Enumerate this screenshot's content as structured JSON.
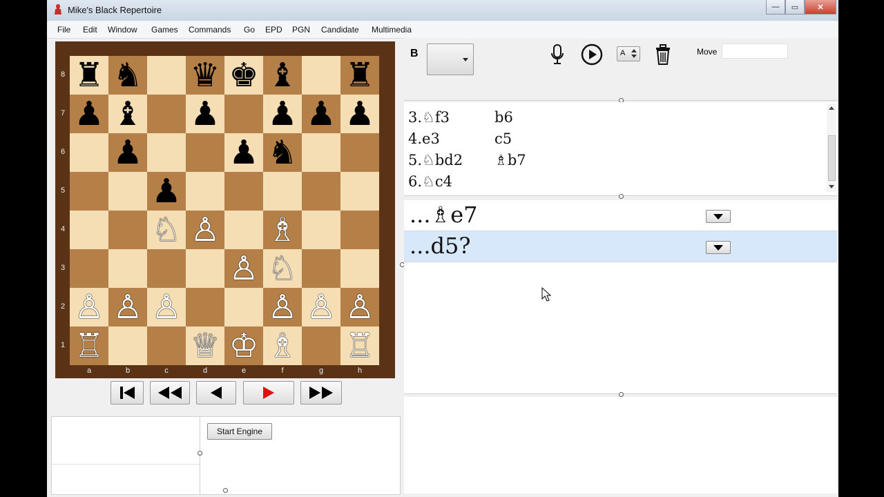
{
  "window": {
    "title": "Mike's Black Repertoire",
    "minimize": "—",
    "maximize": "▭",
    "close": "✕"
  },
  "menu": [
    "File",
    "Edit",
    "Window",
    "Games",
    "Commands",
    "Go",
    "EPD",
    "PGN",
    "Candidate",
    "Multimedia"
  ],
  "board": {
    "ranks": [
      "8",
      "7",
      "6",
      "5",
      "4",
      "3",
      "2",
      "1"
    ],
    "files": [
      "a",
      "b",
      "c",
      "d",
      "e",
      "f",
      "g",
      "h"
    ],
    "position": [
      [
        "bR",
        "bN",
        "",
        "bQ",
        "bK",
        "bB",
        "",
        "bR"
      ],
      [
        "bP",
        "bB",
        "",
        "bP",
        "",
        "bP",
        "bP",
        "bP"
      ],
      [
        "",
        "bP",
        "",
        "",
        "bP",
        "bN",
        "",
        ""
      ],
      [
        "",
        "",
        "bP",
        "",
        "",
        "",
        "",
        ""
      ],
      [
        "",
        "",
        "wN",
        "wP",
        "",
        "wB",
        "",
        ""
      ],
      [
        "",
        "",
        "",
        "",
        "wP",
        "wN",
        "",
        ""
      ],
      [
        "wP",
        "wP",
        "wP",
        "",
        "",
        "wP",
        "wP",
        "wP"
      ],
      [
        "wR",
        "",
        "",
        "wQ",
        "wK",
        "wB",
        "",
        "wR"
      ]
    ],
    "glyphs": {
      "bR": "♜",
      "bN": "♞",
      "bB": "♝",
      "bQ": "♛",
      "bK": "♚",
      "bP": "♟",
      "wR": "♖",
      "wN": "♘",
      "wB": "♗",
      "wQ": "♕",
      "wK": "♔",
      "wP": "♙"
    }
  },
  "nav": {
    "first_icon": "first-move-icon",
    "back_icon": "fast-back-icon",
    "prev_icon": "prev-move-icon",
    "play_icon": "play-icon",
    "forward_icon": "fast-forward-icon"
  },
  "engine": {
    "start_label": "Start Engine"
  },
  "toolbar": {
    "side_label": "B",
    "move_label": "Move",
    "move_value": "",
    "annot_value": "A"
  },
  "moves": [
    {
      "white": "3.♘f3",
      "black": "b6"
    },
    {
      "white": "4.e3",
      "black": "c5"
    },
    {
      "white": "5.♘bd2",
      "black": "♗b7"
    },
    {
      "white": "6.♘c4",
      "black": ""
    }
  ],
  "candidates": [
    {
      "text": "...♗e7",
      "selected": false
    },
    {
      "text": "...d5?",
      "selected": true
    }
  ],
  "colors": {
    "light_square": "#f5deb3",
    "dark_square": "#b48048",
    "selected_row": "#d7e8fa",
    "play_red": "#e01010"
  }
}
